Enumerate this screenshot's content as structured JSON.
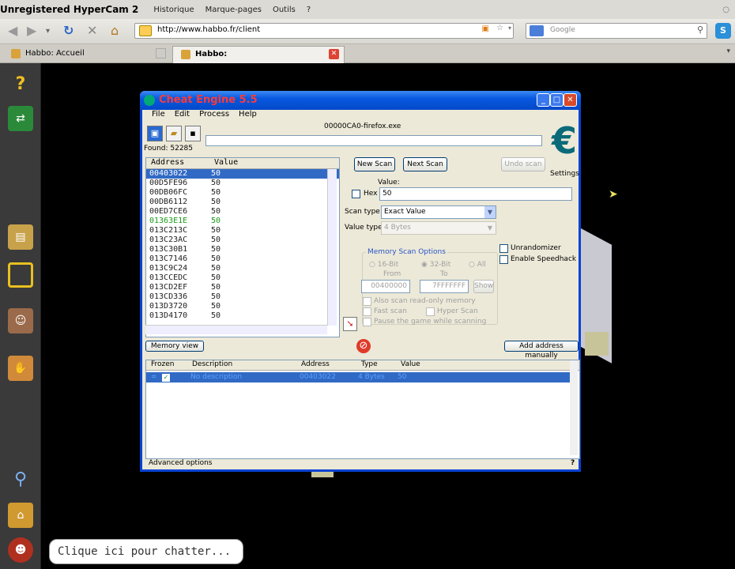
{
  "menubar": {
    "watermark": "Unregistered HyperCam 2",
    "items": [
      "Historique",
      "Marque-pages",
      "Outils",
      "?"
    ]
  },
  "navbar": {
    "url": "http://www.habbo.fr/client",
    "search_placeholder": "Google"
  },
  "tabs": [
    {
      "label": "Habbo: Accueil",
      "active": false
    },
    {
      "label": "Habbo:",
      "active": true
    }
  ],
  "sidebar_icons": [
    "help-icon",
    "navigator-icon",
    "catalogue-icon",
    "inventory-icon",
    "habbo-club-icon",
    "hand-icon",
    "search-icon",
    "rooms-icon",
    "avatar-icon"
  ],
  "chat": {
    "placeholder": "Clique ici pour chatter..."
  },
  "cheat_engine": {
    "title": "Cheat Engine 5.5",
    "menu": [
      "File",
      "Edit",
      "Process",
      "Help"
    ],
    "process": "00000CA0-firefox.exe",
    "found": "Found: 52285",
    "settings_label": "Settings",
    "list_headers": [
      "Address",
      "Value"
    ],
    "addresses": [
      {
        "address": "00403022",
        "value": "50",
        "selected": true
      },
      {
        "address": "00D5FE96",
        "value": "50"
      },
      {
        "address": "00DB06FC",
        "value": "50"
      },
      {
        "address": "00DB6112",
        "value": "50"
      },
      {
        "address": "00ED7CE6",
        "value": "50"
      },
      {
        "address": "01363E1E",
        "value": "50",
        "green": true
      },
      {
        "address": "013C213C",
        "value": "50"
      },
      {
        "address": "013C23AC",
        "value": "50"
      },
      {
        "address": "013C30B1",
        "value": "50"
      },
      {
        "address": "013C7146",
        "value": "50"
      },
      {
        "address": "013C9C24",
        "value": "50"
      },
      {
        "address": "013CCEDC",
        "value": "50"
      },
      {
        "address": "013CD2EF",
        "value": "50"
      },
      {
        "address": "013CD336",
        "value": "50"
      },
      {
        "address": "013D3720",
        "value": "50"
      },
      {
        "address": "013D4170",
        "value": "50"
      }
    ],
    "buttons": {
      "new_scan": "New Scan",
      "next_scan": "Next Scan",
      "undo_scan": "Undo scan",
      "memory_view": "Memory view",
      "add_manually": "Add address manually",
      "show": "Show"
    },
    "value_label": "Value:",
    "hex_label": "Hex",
    "value_input": "50",
    "scan_type_label": "Scan type",
    "scan_type_value": "Exact Value",
    "value_type_label": "Value type",
    "value_type_value": "4 Bytes",
    "memory_scan_options": "Memory Scan Options",
    "bits": [
      "16-Bit",
      "32-Bit",
      "All"
    ],
    "from_label": "From",
    "to_label": "To",
    "from_value": "00400000",
    "to_value": "7FFFFFFF",
    "scan_checks": [
      "Also scan read-only memory",
      "Fast scan",
      "Hyper Scan",
      "Pause the game while scanning"
    ],
    "unrandomizer": "Unrandomizer",
    "enable_speedhack": "Enable Speedhack",
    "table_headers": [
      "Frozen",
      "Description",
      "Address",
      "Type",
      "Value"
    ],
    "table_row": {
      "frozen": "=",
      "description": "No description",
      "address": "00403022",
      "type": "4 Bytes",
      "value": "50"
    },
    "advanced_options": "Advanced options",
    "help_mark": "?"
  }
}
